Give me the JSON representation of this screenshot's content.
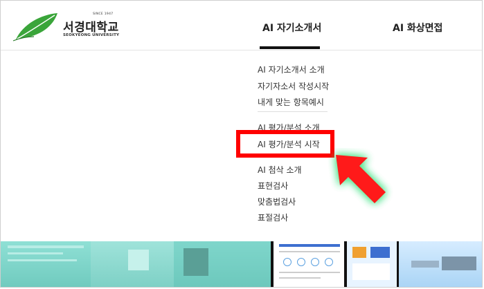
{
  "logo": {
    "name": "서경대학교",
    "since": "SINCE 1947",
    "subtitle": "SEOKYEONG UNIVERSITY"
  },
  "nav": {
    "items": [
      {
        "label": "AI 자기소개서",
        "active": true
      },
      {
        "label": "AI 화상면접",
        "active": false
      }
    ]
  },
  "dropdown": {
    "group1": [
      "AI 자기소개서 소개",
      "자기자소서 작성시작",
      "내게 맞는 항목예시"
    ],
    "group2": [
      "AI 평가/분석 소개",
      "AI 평가/분석 시작"
    ],
    "group3": [
      "AI 첨삭 소개",
      "표현검사",
      "맞춤법검사",
      "표절검사"
    ]
  },
  "colors": {
    "highlight": "#ff0000",
    "arrow": "#ff1a1a",
    "arrow_glow": "#39e07a",
    "brand_green": "#3aa53a",
    "strip_teal": "#7fd6cb"
  }
}
